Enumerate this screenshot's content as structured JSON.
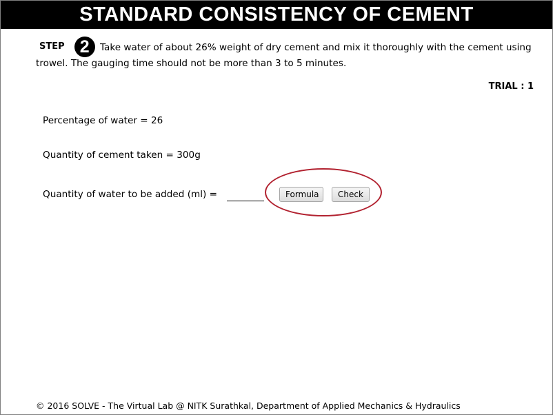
{
  "header": {
    "title": "STANDARD CONSISTENCY OF CEMENT"
  },
  "step": {
    "label": "STEP",
    "number": "2",
    "instruction": "Take water of about 26% weight of dry cement and mix it thoroughly with the cement using trowel. The gauging time should not be more than 3 to 5 minutes."
  },
  "trial": {
    "text": "TRIAL : 1"
  },
  "calculation": {
    "percentage_line": "Percentage of water = 26",
    "cement_line": "Quantity of cement taken = 300g",
    "water_prompt": "Quantity of water to be added (ml) =",
    "water_input_value": ""
  },
  "buttons": {
    "formula_label": "Formula",
    "check_label": "Check"
  },
  "footer": {
    "text": "© 2016 SOLVE - The Virtual Lab @ NITK Surathkal, Department of Applied Mechanics & Hydraulics"
  },
  "colors": {
    "header_background": "#000000",
    "header_text": "#ffffff",
    "highlight_ellipse": "#b22230"
  }
}
